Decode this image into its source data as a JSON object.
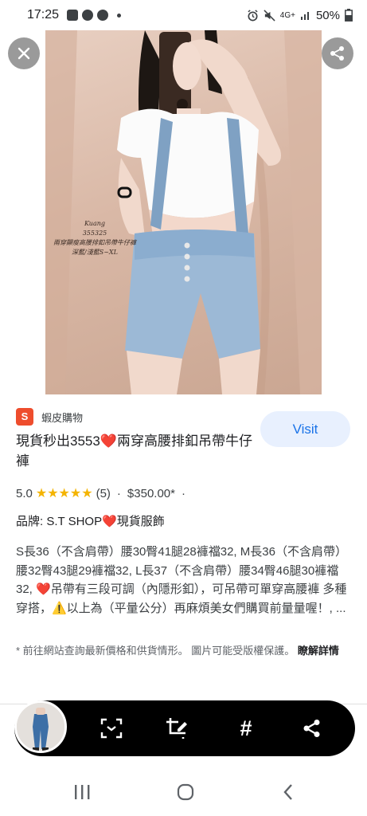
{
  "status_bar": {
    "time": "17:25",
    "network": "4G+",
    "battery": "50%"
  },
  "photo": {
    "caption_line1": "Kuang",
    "caption_line2": "355325",
    "caption_line3": "兩穿顯瘦高腰排釦吊帶牛仔褲",
    "caption_line4": "深藍/淺藍S~XL"
  },
  "source": {
    "logo_text": "S",
    "name": "蝦皮購物"
  },
  "visit_label": "Visit",
  "product": {
    "title": "現貨秒出3553❤️兩穿高腰排釦吊帶牛仔褲",
    "rating": "5.0",
    "stars": "★★★★★",
    "review_count": "(5)",
    "separator": "·",
    "price": "$350.00*",
    "price_suffix": "·",
    "brand": "品牌: S.T SHOP❤️現貨服飾",
    "description": "S長36（不含肩帶）腰30臀41腿28褲襠32, M長36（不含肩帶）腰32臀43腿29褲襠32, L長37（不含肩帶）腰34臀46腿30褲襠32, ❤️吊帶有三段可調（內隱形釦），可吊帶可單穿高腰褲 多種穿搭，⚠️以上為（平量公分）再麻煩美女們購買前量量喔！, ...",
    "note": "* 前往網站查詢最新價格和供貨情形。 圖片可能受版權保護。",
    "note_link": "瞭解詳情"
  },
  "icons": {
    "close": "close-icon",
    "share": "share-icon",
    "scan": "scan-text-icon",
    "crop": "crop-edit-icon",
    "hash": "hashtag-icon",
    "share_tool": "share-icon",
    "recents": "recents-icon",
    "home": "home-icon",
    "back": "back-icon"
  },
  "toolbar": {
    "hash_symbol": "#"
  },
  "colors": {
    "accent": "#1a73e8",
    "visit_bg": "#e8f0fe",
    "shopee": "#ee4d2d",
    "star": "#f4b400",
    "heart": "#e53935"
  }
}
